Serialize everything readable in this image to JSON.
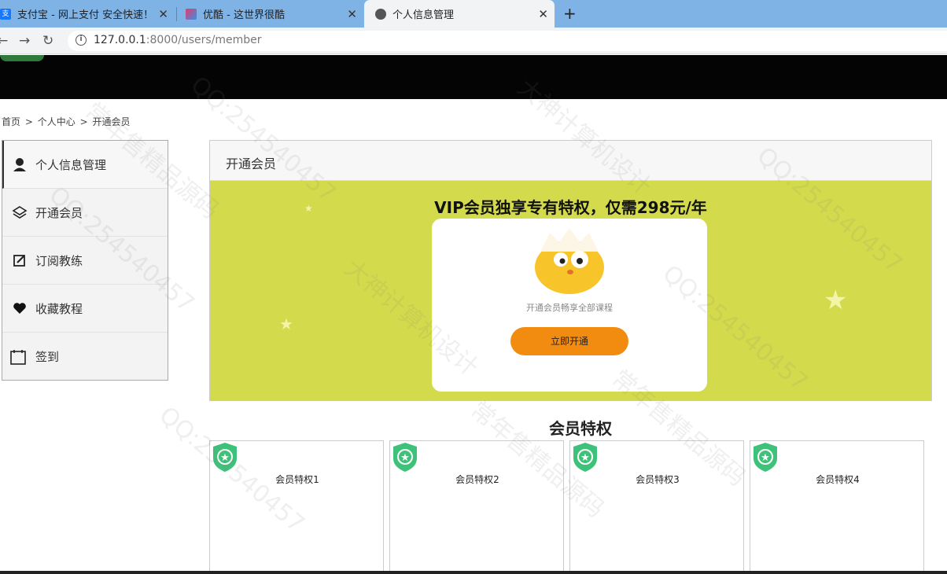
{
  "browser": {
    "tabs": [
      {
        "title": "支付宝 - 网上支付 安全快速！",
        "favicon_color": "#1677ff",
        "active": false
      },
      {
        "title": "优酷 - 这世界很酷",
        "favicon_color": "#e43c6b",
        "active": false
      },
      {
        "title": "个人信息管理",
        "favicon_color": "#555555",
        "active": true
      }
    ],
    "url_host": "127.0.0.1",
    "url_rest": ":8000/users/member"
  },
  "breadcrumb": [
    "首页",
    "个人中心",
    "开通会员"
  ],
  "breadcrumb_sep": ">",
  "sidebar": {
    "items": [
      {
        "label": "个人信息管理",
        "icon": "user-icon"
      },
      {
        "label": "开通会员",
        "icon": "layers-icon"
      },
      {
        "label": "订阅教练",
        "icon": "edit-icon"
      },
      {
        "label": "收藏教程",
        "icon": "heart-icon"
      },
      {
        "label": "签到",
        "icon": "calendar-icon"
      }
    ]
  },
  "panel": {
    "title": "开通会员",
    "banner_title": "VIP会员独享专有特权，仅需298元/年",
    "card_text": "开通会员畅享全部课程",
    "button_label": "立即开通"
  },
  "perks": {
    "title": "会员特权",
    "items": [
      "会员特权1",
      "会员特权2",
      "会员特权3",
      "会员特权4"
    ]
  },
  "watermark": {
    "texts": [
      "QQ:254540457",
      "大神计算机设计",
      "常年售精品源码"
    ]
  },
  "colors": {
    "banner": "#d3db4c",
    "button": "#f28c10",
    "badge": "#3ec27a",
    "header": "#040404"
  }
}
